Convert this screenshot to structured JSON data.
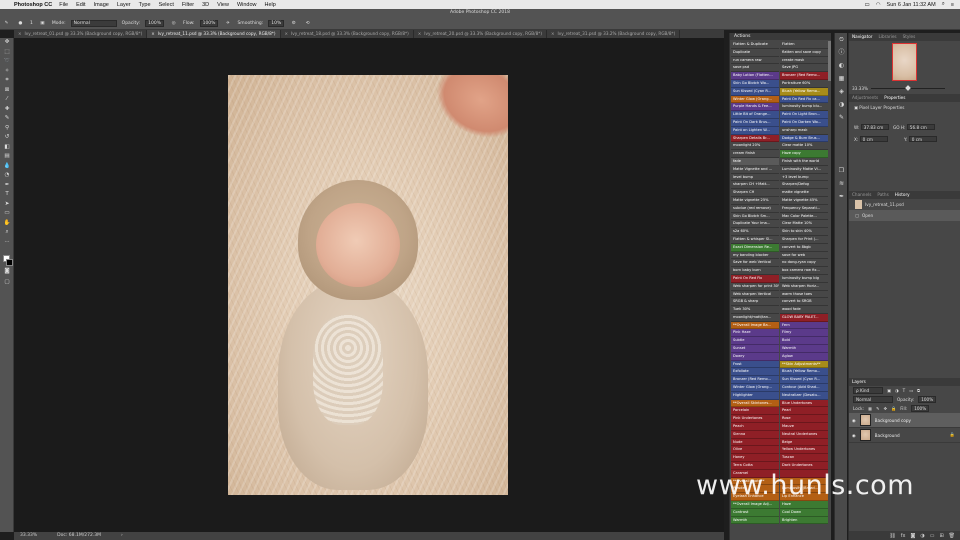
{
  "menubar": {
    "app": "Photoshop CC",
    "items": [
      "File",
      "Edit",
      "Image",
      "Layer",
      "Type",
      "Select",
      "Filter",
      "3D",
      "View",
      "Window",
      "Help"
    ],
    "clock": "Sun 6 Jan 11:32 AM"
  },
  "window": {
    "title": "Adobe Photoshop CC 2018"
  },
  "options": {
    "brush_size": "1",
    "mode_label": "Mode:",
    "mode_value": "Normal",
    "opacity_label": "Opacity:",
    "opacity_value": "100%",
    "flow_label": "Flow:",
    "flow_value": "100%",
    "smoothing_label": "Smoothing:",
    "smoothing_value": "10%"
  },
  "tabs": [
    {
      "label": "Ivy_retreat_01.psd @ 33.3% (Background copy, RGB/8*)",
      "active": false
    },
    {
      "label": "Ivy_retreat_11.psd @ 33.3% (Background copy, RGB/8*)",
      "active": true
    },
    {
      "label": "Ivy_retreat_18.psd @ 33.3% (Background copy, RGB/8*)",
      "active": false
    },
    {
      "label": "Ivy_retreat_20.psd @ 33.3% (Background copy, RGB/8*)",
      "active": false
    },
    {
      "label": "Ivy_retreat_31.psd @ 33.2% (Background copy, RGB/8*)",
      "active": false
    }
  ],
  "status": {
    "zoom": "33.33%",
    "doc": "Doc: 68.1M/272.3M"
  },
  "watermark": "www.hunls.com",
  "actions": {
    "title": "Actions",
    "colors": {
      "none": "#474747",
      "red": "#8f1f26",
      "blue": "#3a4f8c",
      "orange": "#b35f14",
      "yellow": "#a78c1a",
      "green": "#3c7a32",
      "violet": "#5b3a8a",
      "gray": "#5a5a5a"
    },
    "rows": [
      [
        [
          "Flatten & Duplicate",
          "none"
        ],
        [
          "Flatten",
          "none"
        ]
      ],
      [
        [
          "Duplicate",
          "none"
        ],
        [
          "flatten and save copy",
          "none"
        ]
      ],
      [
        [
          "run camera raw",
          "none"
        ],
        [
          "create mask",
          "none"
        ]
      ],
      [
        [
          "save psd",
          "none"
        ],
        [
          "Save JPG",
          "none"
        ]
      ],
      [
        [
          "Baby Lotion (Flatten...",
          "violet"
        ],
        [
          "Bronzer (Red Remo...",
          "red"
        ]
      ],
      [
        [
          "Skin Go Blotch Wo...",
          "blue"
        ],
        [
          "Portraiture 60%",
          "none"
        ]
      ],
      [
        [
          "Sun Kissed (Cyan R...",
          "blue"
        ],
        [
          "Blush (Yellow Remo...",
          "yellow"
        ]
      ],
      [
        [
          "Winter Glow (Orang...",
          "orange"
        ],
        [
          "Paint On Red Fix ca...",
          "blue"
        ]
      ],
      [
        [
          "Purple Hands & Fee...",
          "violet"
        ],
        [
          "luminosity bump blu...",
          "none"
        ]
      ],
      [
        [
          "Little Bit of Orange...",
          "blue"
        ],
        [
          "Paint On Light Bron...",
          "blue"
        ]
      ],
      [
        [
          "Paint On Dark Brus...",
          "blue"
        ],
        [
          "Paint On Darken Wo...",
          "blue"
        ]
      ],
      [
        [
          "Paint on Lighten W...",
          "blue"
        ],
        [
          "unsharp mask",
          "none"
        ]
      ],
      [
        [
          "Sharpen Details Br...",
          "red"
        ],
        [
          "Dodge & Burn Brus...",
          "blue"
        ]
      ],
      [
        [
          "moonlight 20%",
          "none"
        ],
        [
          "Clear matte 10%",
          "none"
        ]
      ],
      [
        [
          "cream finish",
          "none"
        ],
        [
          "Haze copy",
          "green"
        ]
      ],
      [
        [
          "fade",
          "gray"
        ],
        [
          "Finish with the world",
          "none"
        ]
      ],
      [
        [
          "Matte Vignette and ...",
          "none"
        ],
        [
          "Luminosity Matte Vi...",
          "none"
        ]
      ],
      [
        [
          "level bump",
          "none"
        ],
        [
          "+3 level bump",
          "none"
        ]
      ],
      [
        [
          "sharpen CH +Matt...",
          "none"
        ],
        [
          "Sharpen/Defog",
          "none"
        ]
      ],
      [
        [
          "Sharpen CH",
          "none"
        ],
        [
          "matte vignette",
          "none"
        ]
      ],
      [
        [
          "Matte vignette 25%",
          "none"
        ],
        [
          "Matte vignette 45%",
          "none"
        ]
      ],
      [
        [
          "subdue (red remove)",
          "none"
        ],
        [
          "Frequency Separati...",
          "none"
        ]
      ],
      [
        [
          "Skin Go Blotch Sm...",
          "none"
        ],
        [
          "Mac Color Palette...",
          "none"
        ]
      ],
      [
        [
          "Duplicate Your Ima...",
          "none"
        ],
        [
          "Clear Matte 10%",
          "none"
        ]
      ],
      [
        [
          "s2a 60%",
          "none"
        ],
        [
          "Skin to skin 40%",
          "none"
        ]
      ],
      [
        [
          "Flatten & whisper Sl...",
          "none"
        ],
        [
          "Sharpen for Print (...",
          "none"
        ]
      ],
      [
        [
          "Exact Dimension Re...",
          "green"
        ],
        [
          "convert to 8bgb",
          "none"
        ]
      ],
      [
        [
          "my banding blocker",
          "none"
        ],
        [
          "save for web",
          "none"
        ]
      ],
      [
        [
          "Save for web Vertical",
          "none"
        ],
        [
          "no dong-ryan copy",
          "none"
        ]
      ],
      [
        [
          "born baby burn",
          "none"
        ],
        [
          "box camera raw fix...",
          "none"
        ]
      ],
      [
        [
          "Paint On Red Fix",
          "red"
        ],
        [
          "luminosity bump big",
          "none"
        ]
      ],
      [
        [
          "Web sharpen for print 30%",
          "none"
        ],
        [
          "Web sharpen Horiz...",
          "none"
        ]
      ],
      [
        [
          "Web sharpen Vertical",
          "none"
        ],
        [
          "warm those toes",
          "none"
        ]
      ],
      [
        [
          "SRGB & sharp",
          "none"
        ],
        [
          "convert to SRGB",
          "none"
        ]
      ],
      [
        [
          "Tuek 30%",
          "none"
        ],
        [
          "wood fade",
          "none"
        ]
      ],
      [
        [
          "moonlight/matt/tan...",
          "none"
        ],
        [
          "GLOW BABY PALET...",
          "red"
        ]
      ],
      [
        [
          "**Overall Image Ba...",
          "orange"
        ],
        [
          "Fern",
          "violet"
        ]
      ],
      [
        [
          "Pink Haze",
          "violet"
        ],
        [
          "Filmy",
          "violet"
        ]
      ],
      [
        [
          "Subtle",
          "violet"
        ],
        [
          "Bold",
          "violet"
        ]
      ],
      [
        [
          "Sunset",
          "violet"
        ],
        [
          "Warmth",
          "violet"
        ]
      ],
      [
        [
          "Dowry",
          "violet"
        ],
        [
          "Aglow",
          "violet"
        ]
      ],
      [
        [
          "Frost",
          "blue"
        ],
        [
          "**Skin Adjustments**",
          "yellow"
        ]
      ],
      [
        [
          "Exfoliate",
          "blue"
        ],
        [
          "Blush (Yellow Remo...",
          "blue"
        ]
      ],
      [
        [
          "Bronzer (Red Remo...",
          "blue"
        ],
        [
          "Sun Kissed (Cyan R...",
          "blue"
        ]
      ],
      [
        [
          "Winter Glow (Orang...",
          "blue"
        ],
        [
          "Contour (Add Shad...",
          "blue"
        ]
      ],
      [
        [
          "Highlighter",
          "blue"
        ],
        [
          "Neutralizer (Desatu...",
          "blue"
        ]
      ],
      [
        [
          "**Overall Skintones...",
          "orange"
        ],
        [
          "Blue Undertones",
          "red"
        ]
      ],
      [
        [
          "Porcelain",
          "red"
        ],
        [
          "Pearl",
          "red"
        ]
      ],
      [
        [
          "Pink Undertones",
          "red"
        ],
        [
          "Rose",
          "red"
        ]
      ],
      [
        [
          "Peach",
          "red"
        ],
        [
          "Mauve",
          "red"
        ]
      ],
      [
        [
          "Sienna",
          "red"
        ],
        [
          "Neutral Undertones",
          "red"
        ]
      ],
      [
        [
          "Nude",
          "red"
        ],
        [
          "Beige",
          "red"
        ]
      ],
      [
        [
          "Olive",
          "red"
        ],
        [
          "Yellow Undertones",
          "red"
        ]
      ],
      [
        [
          "Honey",
          "red"
        ],
        [
          "Tuscan",
          "red"
        ]
      ],
      [
        [
          "Terra Cotta",
          "red"
        ],
        [
          "Dark Undertones",
          "red"
        ]
      ],
      [
        [
          "Caramel",
          "red"
        ],
        [
          "",
          "red"
        ]
      ],
      [
        [
          "**Overall Photo**",
          "orange"
        ],
        [
          "",
          "orange"
        ]
      ],
      [
        [
          "Powder",
          "orange"
        ],
        [
          "Luminosity (Broad...",
          "orange"
        ]
      ],
      [
        [
          "Eyelash Enhance",
          "orange"
        ],
        [
          "Lip Enhance",
          "orange"
        ]
      ],
      [
        [
          "**Overall Image Adj...",
          "green"
        ],
        [
          "Haze",
          "green"
        ]
      ],
      [
        [
          "Contrast",
          "green"
        ],
        [
          "Cool Down",
          "green"
        ]
      ],
      [
        [
          "Warmth",
          "green"
        ],
        [
          "Brighten",
          "green"
        ]
      ]
    ]
  },
  "navigator": {
    "tabs": [
      "Navigator",
      "Libraries",
      "Styles"
    ],
    "zoom": "33.33%"
  },
  "properties": {
    "tabs": [
      "Adjustments",
      "Properties"
    ],
    "heading": "Pixel Layer Properties",
    "w_label": "W:",
    "w_value": "37.83 cm",
    "go_label": "GO",
    "h_label": "H:",
    "h_value": "56.8 cm",
    "x_label": "X:",
    "x_value": "0 cm",
    "y_label": "Y:",
    "y_value": "0 cm"
  },
  "history": {
    "tabs": [
      "Channels",
      "Paths",
      "History"
    ],
    "items": [
      {
        "label": "Ivy_retreat_11.psd",
        "selected": false
      },
      {
        "label": "Open",
        "selected": true
      }
    ]
  },
  "layers": {
    "title": "Layers",
    "kind": "ρ Kind",
    "blend": "Normal",
    "opacity_label": "Opacity:",
    "opacity_value": "100%",
    "lock_label": "Lock:",
    "fill_label": "Fill:",
    "fill_value": "100%",
    "items": [
      {
        "name": "Background copy",
        "selected": true
      },
      {
        "name": "Background",
        "selected": false
      }
    ]
  }
}
